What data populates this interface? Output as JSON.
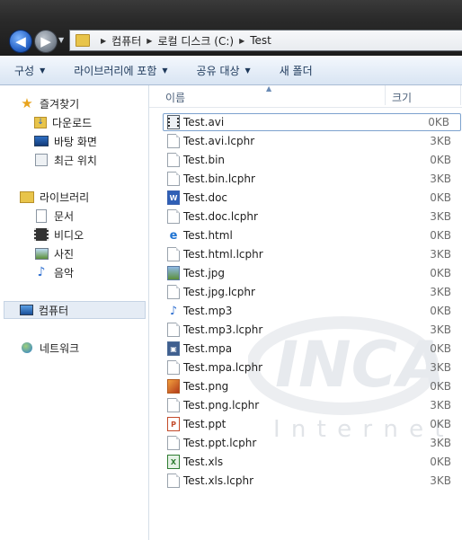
{
  "address": {
    "parts": [
      "컴퓨터",
      "로컬 디스크 (C:)",
      "Test"
    ]
  },
  "toolbar": {
    "organize": "구성",
    "library": "라이브러리에 포함",
    "share": "공유 대상",
    "new_folder": "새 폴더"
  },
  "nav": {
    "favorites": "즐겨찾기",
    "downloads": "다운로드",
    "desktop": "바탕 화면",
    "recent": "최근 위치",
    "libraries": "라이브러리",
    "documents": "문서",
    "videos": "비디오",
    "pictures": "사진",
    "music": "음악",
    "computer": "컴퓨터",
    "network": "네트워크"
  },
  "columns": {
    "name": "이름",
    "size": "크기"
  },
  "files": [
    {
      "name": "Test.avi",
      "size": "0KB",
      "icon": "video-icon"
    },
    {
      "name": "Test.avi.lcphr",
      "size": "3KB",
      "icon": "file-icon"
    },
    {
      "name": "Test.bin",
      "size": "0KB",
      "icon": "file-icon"
    },
    {
      "name": "Test.bin.lcphr",
      "size": "3KB",
      "icon": "file-icon"
    },
    {
      "name": "Test.doc",
      "size": "0KB",
      "icon": "word-icon"
    },
    {
      "name": "Test.doc.lcphr",
      "size": "3KB",
      "icon": "file-icon"
    },
    {
      "name": "Test.html",
      "size": "0KB",
      "icon": "ie-icon"
    },
    {
      "name": "Test.html.lcphr",
      "size": "3KB",
      "icon": "file-icon"
    },
    {
      "name": "Test.jpg",
      "size": "0KB",
      "icon": "image-icon"
    },
    {
      "name": "Test.jpg.lcphr",
      "size": "3KB",
      "icon": "file-icon"
    },
    {
      "name": "Test.mp3",
      "size": "0KB",
      "icon": "music-icon"
    },
    {
      "name": "Test.mp3.lcphr",
      "size": "3KB",
      "icon": "file-icon"
    },
    {
      "name": "Test.mpa",
      "size": "0KB",
      "icon": "media-icon"
    },
    {
      "name": "Test.mpa.lcphr",
      "size": "3KB",
      "icon": "file-icon"
    },
    {
      "name": "Test.png",
      "size": "0KB",
      "icon": "png-icon"
    },
    {
      "name": "Test.png.lcphr",
      "size": "3KB",
      "icon": "file-icon"
    },
    {
      "name": "Test.ppt",
      "size": "0KB",
      "icon": "powerpoint-icon"
    },
    {
      "name": "Test.ppt.lcphr",
      "size": "3KB",
      "icon": "file-icon"
    },
    {
      "name": "Test.xls",
      "size": "0KB",
      "icon": "excel-icon"
    },
    {
      "name": "Test.xls.lcphr",
      "size": "3KB",
      "icon": "file-icon"
    }
  ],
  "watermark": {
    "logo": "INCA",
    "sub": "I n t e r n e t"
  }
}
